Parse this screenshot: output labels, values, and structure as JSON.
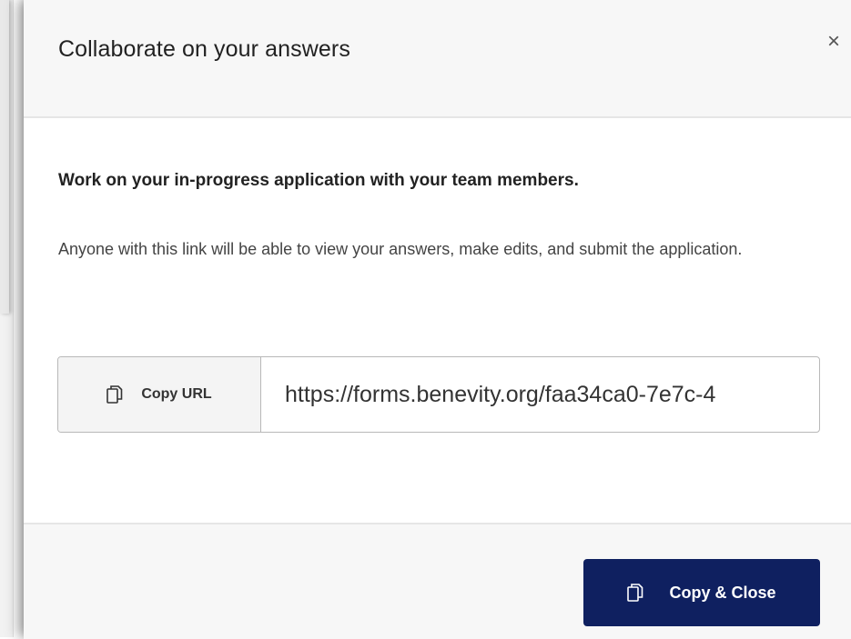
{
  "dialog": {
    "title": "Collaborate on your answers",
    "close_glyph": "×",
    "lead": "Work on your in-progress application with your team members.",
    "description": "Anyone with this link will be able to view your answers, make edits, and submit the application.",
    "copy_url_label": "Copy URL",
    "url_value": "https://forms.benevity.org/faa34ca0-7e7c-4",
    "copy_close_label": "Copy & Close"
  },
  "icons": {
    "copy": "copy-icon",
    "close": "close-icon"
  },
  "colors": {
    "primary_button": "#0f2060",
    "header_bg": "#f7f7f7",
    "text": "#222222"
  }
}
